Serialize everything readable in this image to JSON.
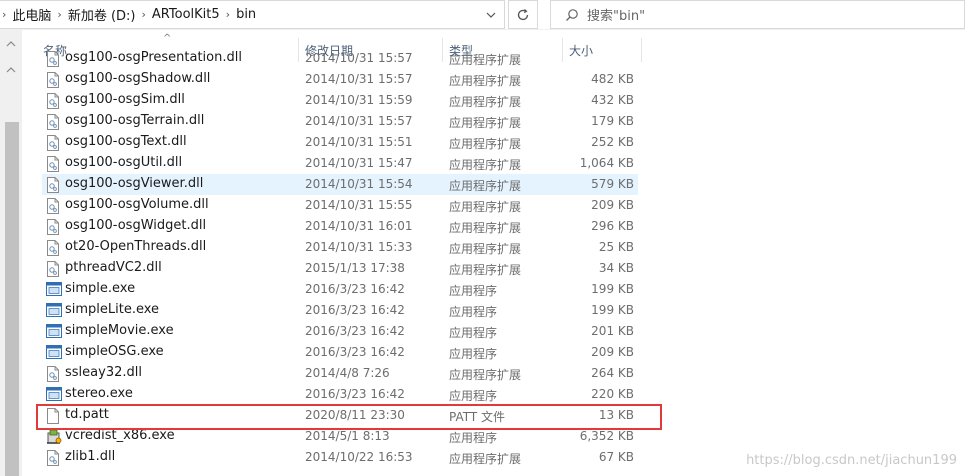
{
  "address_bar": {
    "crumbs": [
      "此电脑",
      "新加卷 (D:)",
      "ARToolKit5",
      "bin"
    ]
  },
  "search": {
    "placeholder": "搜索\"bin\""
  },
  "columns": {
    "name": "名称",
    "date": "修改日期",
    "type": "类型",
    "size": "大小"
  },
  "rows": [
    {
      "name": "osg100-osgPresentation.dll",
      "date": "2014/10/31 15:57",
      "type": "应用程序扩展",
      "size": "",
      "icon": "dll-file-icon"
    },
    {
      "name": "osg100-osgShadow.dll",
      "date": "2014/10/31 15:57",
      "type": "应用程序扩展",
      "size": "482 KB",
      "icon": "dll-file-icon"
    },
    {
      "name": "osg100-osgSim.dll",
      "date": "2014/10/31 15:59",
      "type": "应用程序扩展",
      "size": "432 KB",
      "icon": "dll-file-icon"
    },
    {
      "name": "osg100-osgTerrain.dll",
      "date": "2014/10/31 15:57",
      "type": "应用程序扩展",
      "size": "179 KB",
      "icon": "dll-file-icon"
    },
    {
      "name": "osg100-osgText.dll",
      "date": "2014/10/31 15:51",
      "type": "应用程序扩展",
      "size": "252 KB",
      "icon": "dll-file-icon"
    },
    {
      "name": "osg100-osgUtil.dll",
      "date": "2014/10/31 15:47",
      "type": "应用程序扩展",
      "size": "1,064 KB",
      "icon": "dll-file-icon"
    },
    {
      "name": "osg100-osgViewer.dll",
      "date": "2014/10/31 15:54",
      "type": "应用程序扩展",
      "size": "579 KB",
      "icon": "dll-file-icon",
      "selected": true
    },
    {
      "name": "osg100-osgVolume.dll",
      "date": "2014/10/31 15:55",
      "type": "应用程序扩展",
      "size": "209 KB",
      "icon": "dll-file-icon"
    },
    {
      "name": "osg100-osgWidget.dll",
      "date": "2014/10/31 16:01",
      "type": "应用程序扩展",
      "size": "296 KB",
      "icon": "dll-file-icon"
    },
    {
      "name": "ot20-OpenThreads.dll",
      "date": "2014/10/31 15:33",
      "type": "应用程序扩展",
      "size": "25 KB",
      "icon": "dll-file-icon"
    },
    {
      "name": "pthreadVC2.dll",
      "date": "2015/1/13 17:38",
      "type": "应用程序扩展",
      "size": "34 KB",
      "icon": "dll-file-icon"
    },
    {
      "name": "simple.exe",
      "date": "2016/3/23 16:42",
      "type": "应用程序",
      "size": "199 KB",
      "icon": "exe-file-icon"
    },
    {
      "name": "simpleLite.exe",
      "date": "2016/3/23 16:42",
      "type": "应用程序",
      "size": "199 KB",
      "icon": "exe-file-icon"
    },
    {
      "name": "simpleMovie.exe",
      "date": "2016/3/23 16:42",
      "type": "应用程序",
      "size": "201 KB",
      "icon": "exe-file-icon"
    },
    {
      "name": "simpleOSG.exe",
      "date": "2016/3/23 16:42",
      "type": "应用程序",
      "size": "209 KB",
      "icon": "exe-file-icon"
    },
    {
      "name": "ssleay32.dll",
      "date": "2014/4/8 7:26",
      "type": "应用程序扩展",
      "size": "264 KB",
      "icon": "dll-file-icon"
    },
    {
      "name": "stereo.exe",
      "date": "2016/3/23 16:42",
      "type": "应用程序",
      "size": "220 KB",
      "icon": "exe-file-icon"
    },
    {
      "name": "td.patt",
      "date": "2020/8/11 23:30",
      "type": "PATT 文件",
      "size": "13 KB",
      "icon": "blank-file-icon"
    },
    {
      "name": "vcredist_x86.exe",
      "date": "2014/5/1 8:13",
      "type": "应用程序",
      "size": "6,352 KB",
      "icon": "installer-icon"
    },
    {
      "name": "zlib1.dll",
      "date": "2014/10/22 16:53",
      "type": "应用程序扩展",
      "size": "67 KB",
      "icon": "dll-file-icon"
    }
  ],
  "watermark": "https://blog.csdn.net/jiachun199"
}
